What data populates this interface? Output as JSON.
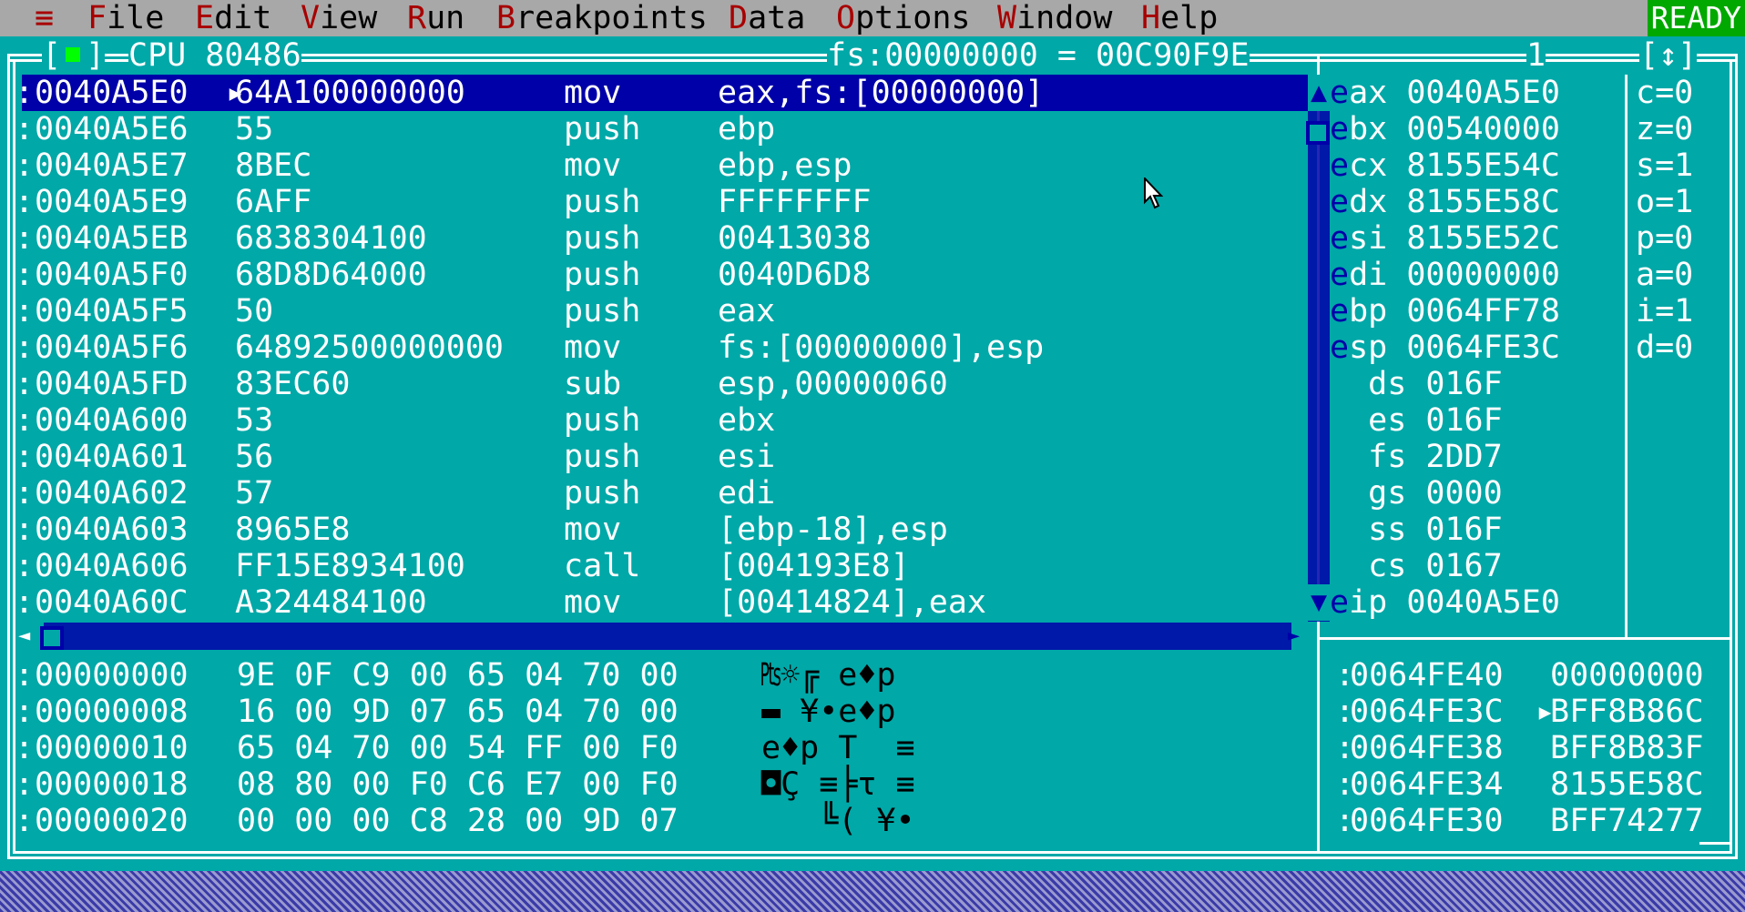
{
  "menu": {
    "system_icon": "≡",
    "items": [
      {
        "hot": "F",
        "rest": "ile"
      },
      {
        "hot": "E",
        "rest": "dit"
      },
      {
        "hot": "V",
        "rest": "iew"
      },
      {
        "hot": "R",
        "rest": "un"
      },
      {
        "hot": "B",
        "rest": "reakpoints"
      },
      {
        "hot": "D",
        "rest": "ata"
      },
      {
        "hot": "O",
        "rest": "ptions"
      },
      {
        "hot": "W",
        "rest": "indow"
      },
      {
        "hot": "H",
        "rest": "elp"
      }
    ],
    "status": "READY"
  },
  "window": {
    "close_box_open": "[",
    "close_box_close": "]",
    "title": "CPU 80486",
    "segment_info": "fs:00000000 = 00C90F9E",
    "window_number": "1",
    "zoom_icon": "[↕]"
  },
  "code": {
    "rows": [
      {
        "addr": "0040A5E0",
        "marker": "▸",
        "bytes": "64A100000000",
        "op": "mov",
        "args": "eax,fs:[00000000]"
      },
      {
        "addr": "0040A5E6",
        "marker": " ",
        "bytes": "55",
        "op": "push",
        "args": "ebp"
      },
      {
        "addr": "0040A5E7",
        "marker": " ",
        "bytes": "8BEC",
        "op": "mov",
        "args": "ebp,esp"
      },
      {
        "addr": "0040A5E9",
        "marker": " ",
        "bytes": "6AFF",
        "op": "push",
        "args": "FFFFFFFF"
      },
      {
        "addr": "0040A5EB",
        "marker": " ",
        "bytes": "6838304100",
        "op": "push",
        "args": "00413038"
      },
      {
        "addr": "0040A5F0",
        "marker": " ",
        "bytes": "68D8D64000",
        "op": "push",
        "args": "0040D6D8"
      },
      {
        "addr": "0040A5F5",
        "marker": " ",
        "bytes": "50",
        "op": "push",
        "args": "eax"
      },
      {
        "addr": "0040A5F6",
        "marker": " ",
        "bytes": "64892500000000",
        "op": "mov",
        "args": "fs:[00000000],esp"
      },
      {
        "addr": "0040A5FD",
        "marker": " ",
        "bytes": "83EC60",
        "op": "sub",
        "args": "esp,00000060"
      },
      {
        "addr": "0040A600",
        "marker": " ",
        "bytes": "53",
        "op": "push",
        "args": "ebx"
      },
      {
        "addr": "0040A601",
        "marker": " ",
        "bytes": "56",
        "op": "push",
        "args": "esi"
      },
      {
        "addr": "0040A602",
        "marker": " ",
        "bytes": "57",
        "op": "push",
        "args": "edi"
      },
      {
        "addr": "0040A603",
        "marker": " ",
        "bytes": "8965E8",
        "op": "mov",
        "args": "[ebp-18],esp"
      },
      {
        "addr": "0040A606",
        "marker": " ",
        "bytes": "FF15E8934100",
        "op": "call",
        "args": "[004193E8]"
      },
      {
        "addr": "0040A60C",
        "marker": " ",
        "bytes": "A324484100",
        "op": "mov",
        "args": "[00414824],eax"
      }
    ]
  },
  "registers": [
    {
      "first": "e",
      "rest": "ax",
      "value": "0040A5E0"
    },
    {
      "first": "e",
      "rest": "bx",
      "value": "00540000"
    },
    {
      "first": "e",
      "rest": "cx",
      "value": "8155E54C"
    },
    {
      "first": "e",
      "rest": "dx",
      "value": "8155E58C"
    },
    {
      "first": "e",
      "rest": "si",
      "value": "8155E52C"
    },
    {
      "first": "e",
      "rest": "di",
      "value": "00000000"
    },
    {
      "first": "e",
      "rest": "bp",
      "value": "0064FF78"
    },
    {
      "first": "e",
      "rest": "sp",
      "value": "0064FE3C"
    },
    {
      "first": "",
      "rest": "  ds",
      "value": "016F"
    },
    {
      "first": "",
      "rest": "  es",
      "value": "016F"
    },
    {
      "first": "",
      "rest": "  fs",
      "value": "2DD7"
    },
    {
      "first": "",
      "rest": "  gs",
      "value": "0000"
    },
    {
      "first": "",
      "rest": "  ss",
      "value": "016F"
    },
    {
      "first": "",
      "rest": "  cs",
      "value": "0167"
    },
    {
      "first": "e",
      "rest": "ip",
      "value": "0040A5E0"
    }
  ],
  "flags": [
    "c=0",
    "z=0",
    "s=1",
    "o=1",
    "p=0",
    "a=0",
    "i=1",
    "d=0"
  ],
  "dump": [
    {
      "addr": "00000000",
      "bytes": "9E 0F C9 00 65 04 70 00",
      "ascii": "₧☼╔ e♦p"
    },
    {
      "addr": "00000008",
      "bytes": "16 00 9D 07 65 04 70 00",
      "ascii": "▬ ¥•e♦p"
    },
    {
      "addr": "00000010",
      "bytes": "65 04 70 00 54 FF 00 F0",
      "ascii": "e♦p T  ≡"
    },
    {
      "addr": "00000018",
      "bytes": "08 80 00 F0 C6 E7 00 F0",
      "ascii": "◘Ç ≡╞τ ≡"
    },
    {
      "addr": "00000020",
      "bytes": "00 00 00 C8 28 00 9D 07",
      "ascii": "   ╚( ¥•"
    }
  ],
  "stack": [
    {
      "addr": "0064FE40",
      "marker": " ",
      "value": "00000000"
    },
    {
      "addr": "0064FE3C",
      "marker": "▸",
      "value": "BFF8B86C"
    },
    {
      "addr": "0064FE38",
      "marker": " ",
      "value": "BFF8B83F"
    },
    {
      "addr": "0064FE34",
      "marker": " ",
      "value": "8155E58C"
    },
    {
      "addr": "0064FE30",
      "marker": " ",
      "value": "BFF74277"
    }
  ]
}
